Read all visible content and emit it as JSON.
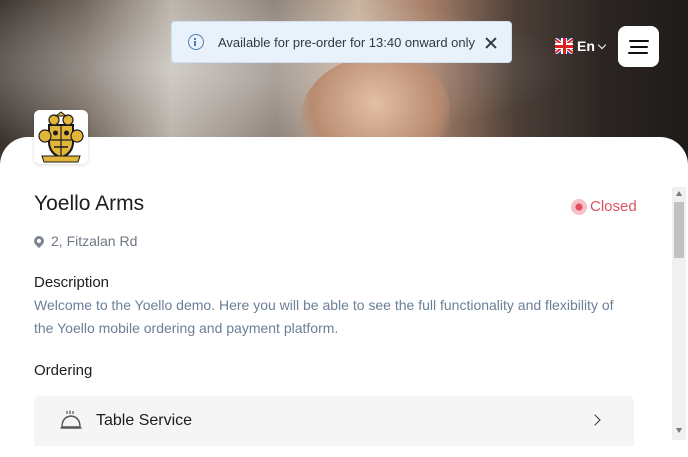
{
  "notice": {
    "message": "Available for pre-order for 13:40 onward only",
    "icon": "info-icon",
    "close_icon": "close-icon"
  },
  "language": {
    "label": "En",
    "flag_icon": "uk-flag-icon"
  },
  "menu": {
    "icon": "hamburger-menu-icon"
  },
  "venue": {
    "name": "Yoello Arms",
    "status": "Closed",
    "status_color": "#d85462",
    "address": "2, Fitzalan Rd"
  },
  "description": {
    "heading": "Description",
    "text": "Welcome to the Yoello demo.  Here you will be able to see the full functionality and flexibility of the Yoello mobile ordering and payment platform."
  },
  "ordering": {
    "heading": "Ordering",
    "options": [
      {
        "label": "Table Service",
        "icon": "cloche-icon"
      }
    ]
  },
  "colors": {
    "notice_bg": "#e9f2fb",
    "description_text": "#6b7f96",
    "option_bg": "#f5f5f6"
  }
}
